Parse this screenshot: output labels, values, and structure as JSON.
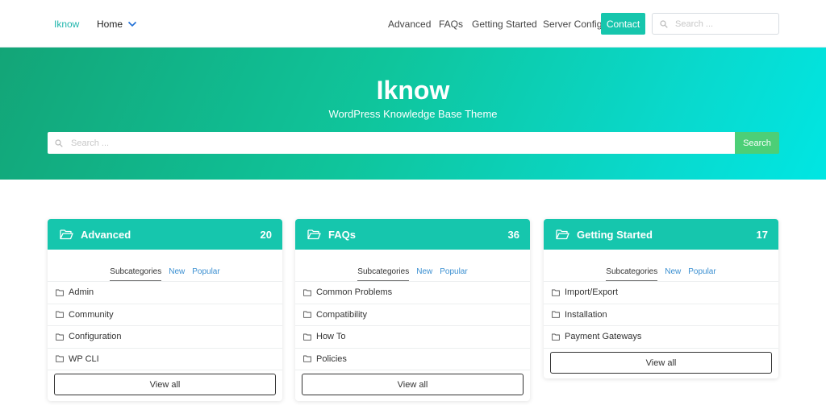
{
  "header": {
    "brand": "Iknow",
    "home_label": "Home",
    "nav": [
      "Advanced",
      "FAQs",
      "Getting Started",
      "Server Config"
    ],
    "contact_label": "Contact",
    "search_placeholder": "Search ..."
  },
  "hero": {
    "title": "Iknow",
    "subtitle": "WordPress Knowledge Base Theme",
    "search_placeholder": "Search ...",
    "search_button": "Search"
  },
  "tabs": [
    "Subcategories",
    "New",
    "Popular"
  ],
  "cards": [
    {
      "title": "Advanced",
      "count": "20",
      "items": [
        "Admin",
        "Community",
        "Configuration",
        "WP CLI"
      ],
      "view_all": "View all"
    },
    {
      "title": "FAQs",
      "count": "36",
      "items": [
        "Common Problems",
        "Compatibility",
        "How To",
        "Policies"
      ],
      "view_all": "View all"
    },
    {
      "title": "Getting Started",
      "count": "17",
      "items": [
        "Import/Export",
        "Installation",
        "Payment Gateways"
      ],
      "view_all": "View all"
    }
  ],
  "colors": {
    "accent": "#16c6ad",
    "brand_text": "#1fb5ac",
    "search_button": "#4ccf77",
    "link": "#3a8fd1"
  },
  "icons": {
    "dropdown": "chevron-down-icon",
    "search": "search-icon",
    "card_header": "folder-open-icon",
    "item": "folder-icon"
  }
}
